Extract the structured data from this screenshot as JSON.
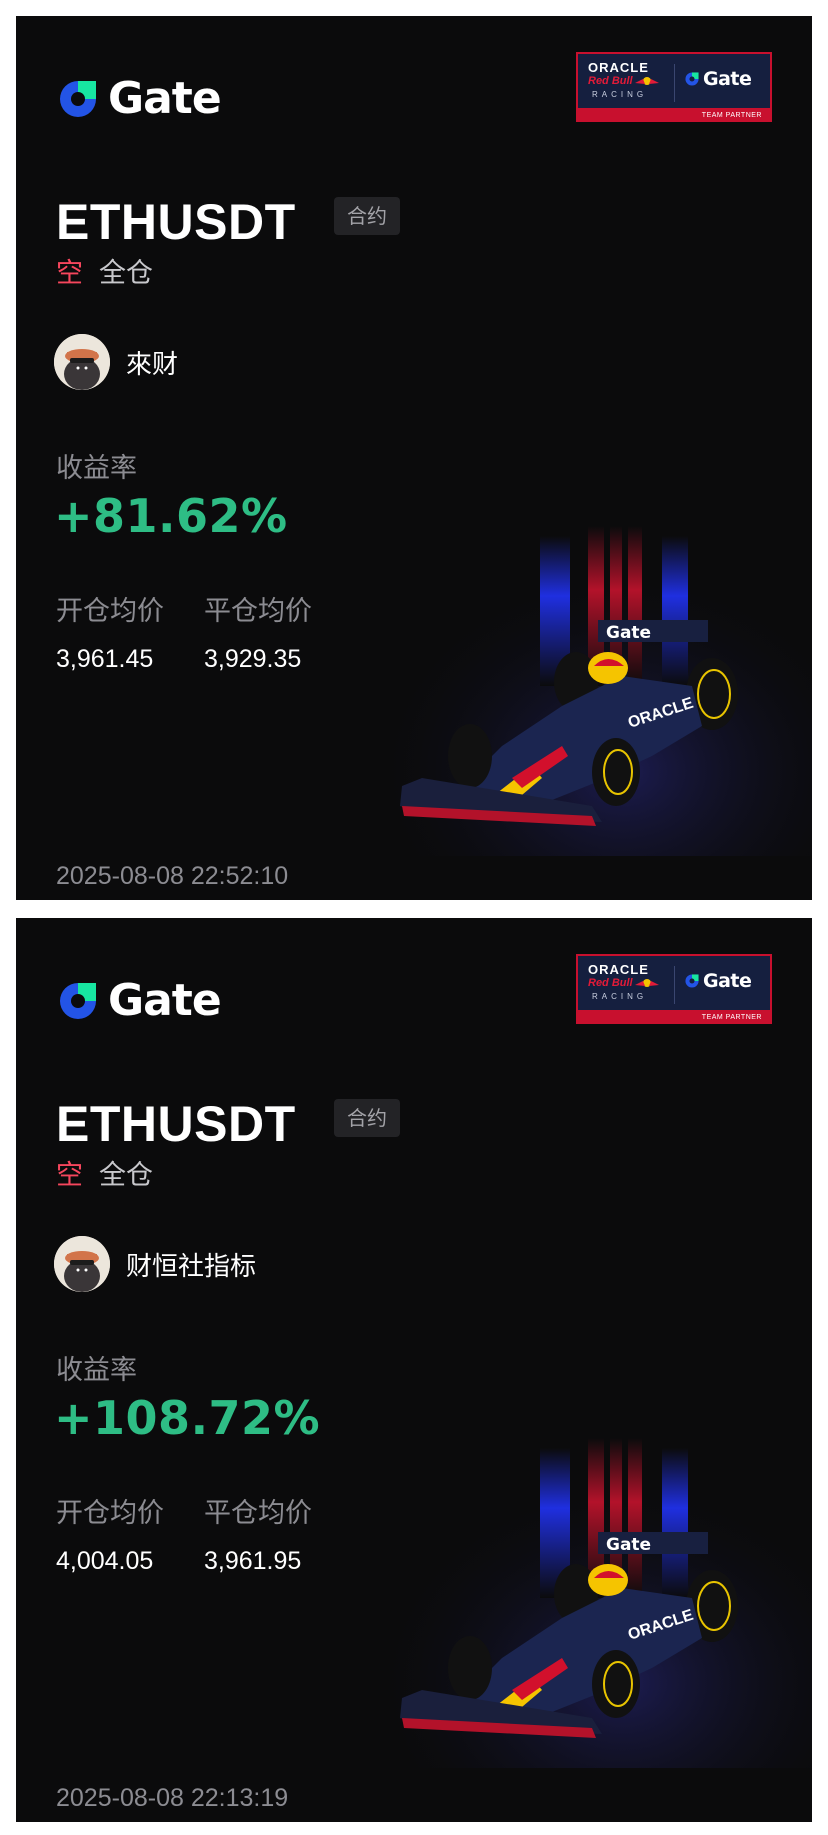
{
  "cards": [
    {
      "brand": "Gate",
      "partner": {
        "oracle": "ORACLE",
        "redbull": "Red Bull",
        "racing": "RACING",
        "gate": "Gate",
        "tag": "TEAM PARTNER"
      },
      "symbol": "ETHUSDT",
      "type_badge": "合约",
      "direction": "空",
      "margin_mode": "全仓",
      "author": "來财",
      "roi_label": "收益率",
      "roi_value": "+81.62%",
      "entry_label": "开仓均价",
      "entry_price": "3,961.45",
      "exit_label": "平仓均价",
      "exit_price": "3,929.35",
      "timestamp": "2025-08-08 22:52:10",
      "car_wing_text": "Gate",
      "car_sidepod_text": "ORACLE"
    },
    {
      "brand": "Gate",
      "partner": {
        "oracle": "ORACLE",
        "redbull": "Red Bull",
        "racing": "RACING",
        "gate": "Gate",
        "tag": "TEAM PARTNER"
      },
      "symbol": "ETHUSDT",
      "type_badge": "合约",
      "direction": "空",
      "margin_mode": "全仓",
      "author": "财恒社指标",
      "roi_label": "收益率",
      "roi_value": "+108.72%",
      "entry_label": "开仓均价",
      "entry_price": "4,004.05",
      "exit_label": "平仓均价",
      "exit_price": "3,961.95",
      "timestamp": "2025-08-08 22:13:19",
      "car_wing_text": "Gate",
      "car_sidepod_text": "ORACLE"
    }
  ],
  "colors": {
    "background": "#0b0b0c",
    "roi_positive": "#2ebd85",
    "short": "#f6465d",
    "gate_blue": "#2354e6",
    "gate_green": "#17e6a1",
    "partner_navy": "#151f3f",
    "partner_red": "#c8102e"
  },
  "icons": [
    "gate-logo-icon",
    "red-bull-icon",
    "avatar-image",
    "f1-car-image"
  ]
}
